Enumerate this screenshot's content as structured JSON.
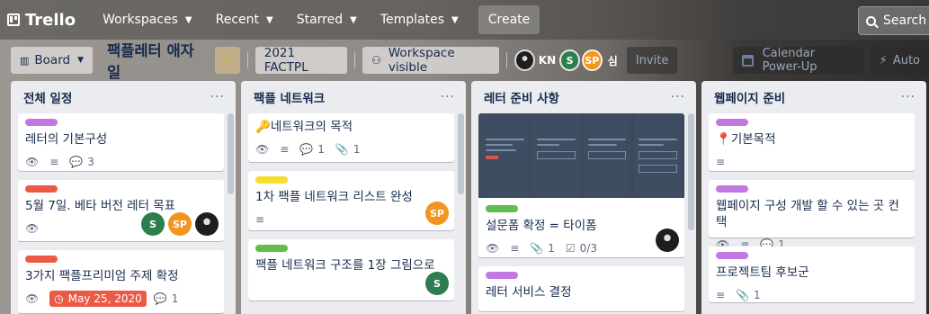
{
  "header": {
    "logo_text": "Trello",
    "nav": [
      {
        "label": "Workspaces",
        "has_chevron": true
      },
      {
        "label": "Recent",
        "has_chevron": true
      },
      {
        "label": "Starred",
        "has_chevron": true
      },
      {
        "label": "Templates",
        "has_chevron": true
      }
    ],
    "create_label": "Create",
    "search_placeholder": "Search"
  },
  "board": {
    "view_label": "Board",
    "title": "팩플레터 애자일",
    "workspace_name": "2021 FACTPL",
    "visibility_label": "Workspace visible",
    "members": [
      {
        "type": "photo",
        "initials": ""
      },
      {
        "type": "text",
        "initials": "KN"
      },
      {
        "type": "green",
        "initials": "S"
      },
      {
        "type": "orange",
        "initials": "SP"
      },
      {
        "type": "text",
        "initials": "심"
      }
    ],
    "invite_label": "Invite",
    "powerup_label": "Calendar Power-Up",
    "automation_label": "Auto"
  },
  "lists": [
    {
      "title": "전체 일정",
      "menu": "···",
      "cards": [
        {
          "label": "purple",
          "title": "레터의 기본구성",
          "badges": {
            "watch": true,
            "description": true,
            "comments": "3"
          }
        },
        {
          "label": "red",
          "title": "5월 7일. 베타 버전 레터 목표",
          "badges": {
            "watch": true
          },
          "members": [
            "S",
            "SP",
            "photo"
          ]
        },
        {
          "label": "red",
          "title": "3가지 팩플프리미엄 주제 확정",
          "badges": {
            "watch": true,
            "due": "May 25, 2020",
            "comments": "1"
          }
        }
      ]
    },
    {
      "title": "팩플 네트워크",
      "menu": "···",
      "cards": [
        {
          "label": "",
          "title_icon": "🔑",
          "title": "네트워크의 목적",
          "badges": {
            "watch": true,
            "description": true,
            "comments": "1",
            "attachments": "1"
          }
        },
        {
          "label": "yellow",
          "title": "1차 팩플 네트워크 리스트 완성",
          "badges": {
            "description": true
          },
          "members": [
            "SP"
          ]
        },
        {
          "label": "green",
          "title": "팩플 네트워크 구조를 1장 그림으로",
          "members": [
            "S"
          ]
        }
      ]
    },
    {
      "title": "레터 준비 사항",
      "menu": "···",
      "cards": [
        {
          "label": "green",
          "title": "설문폼 확정 = 타이폼",
          "badges": {
            "watch": true,
            "description": true,
            "attachments": "1",
            "checklist": "0/3"
          },
          "members": [
            "photo"
          ],
          "has_cover": true
        },
        {
          "label": "purple",
          "title": "레터 서비스 결정"
        }
      ]
    },
    {
      "title": "웹페이지 준비",
      "menu": "···",
      "cards": [
        {
          "label": "purple",
          "title_icon": "📍",
          "title": "기본목적",
          "badges": {
            "description": true
          }
        },
        {
          "label": "purple",
          "title": "웹페이지 구성 개발 할 수 있는 곳 컨택",
          "badges": {
            "watch": true,
            "description": true,
            "comments": "1"
          }
        },
        {
          "label": "purple",
          "title": "프로젝트팀 후보군",
          "badges": {
            "description": true,
            "attachments": "1"
          }
        }
      ]
    }
  ],
  "colors": {
    "label_purple": "#c377e0",
    "label_red": "#eb5a46",
    "label_yellow": "#f5dd29",
    "label_green": "#61bd4f",
    "avatar_green": "#2e7d4f",
    "avatar_orange": "#f2951c"
  }
}
